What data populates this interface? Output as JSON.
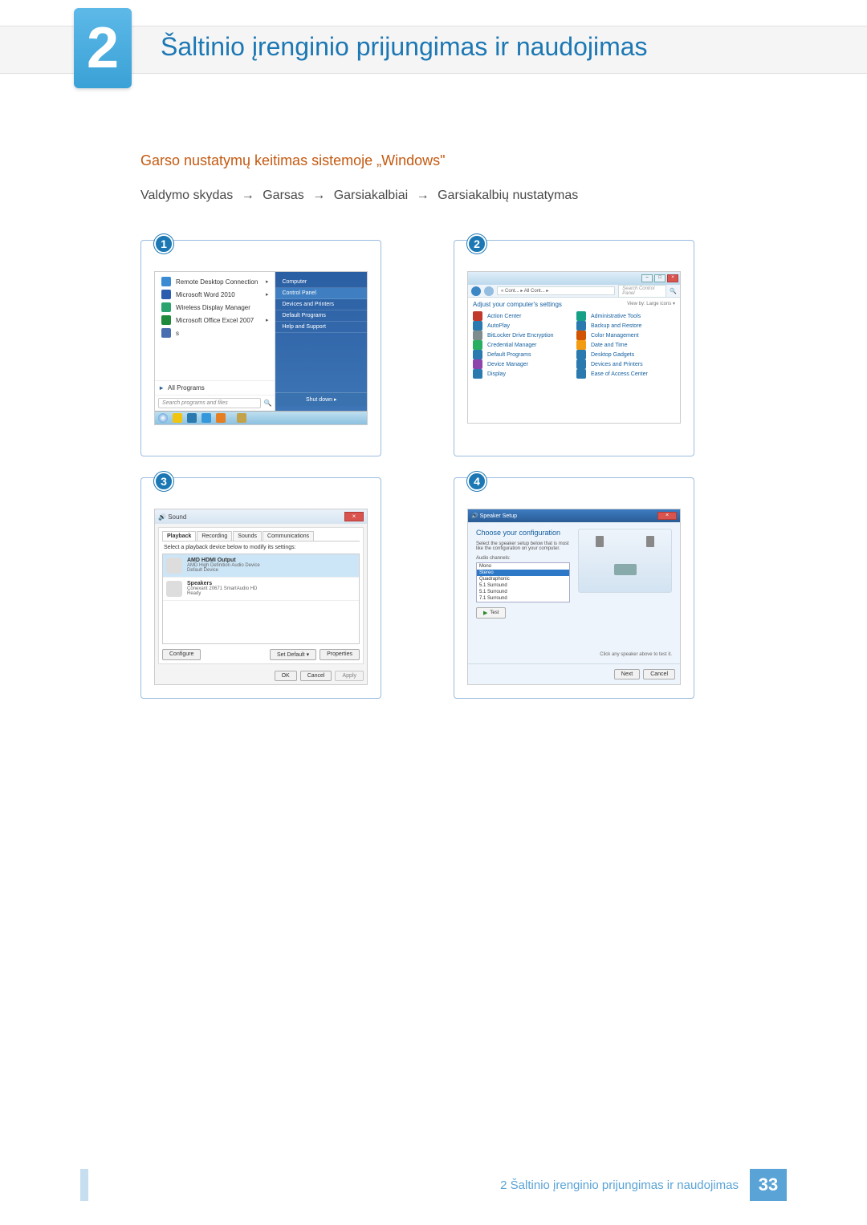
{
  "chapter": {
    "number": "2",
    "title": "Šaltinio įrenginio prijungimas ir naudojimas"
  },
  "section_heading": "Garso nustatymų keitimas sistemoje „Windows\"",
  "path": {
    "prefix": "Valdymo skydas",
    "s1": "Garsas",
    "s2": "Garsiakalbiai",
    "s3": "Garsiakalbių nustatymas",
    "arrow": "→"
  },
  "fig1": {
    "num": "1",
    "left_items": [
      {
        "label": "Remote Desktop Connection",
        "color": "#3a8bd4",
        "chev": true
      },
      {
        "label": "Microsoft Word 2010",
        "color": "#2a5db0",
        "chev": true
      },
      {
        "label": "Wireless Display Manager",
        "color": "#2aa36f",
        "chev": false
      },
      {
        "label": "Microsoft Office Excel 2007",
        "color": "#1f8a3b",
        "chev": true
      },
      {
        "label": "s",
        "color": "#4a6fb0",
        "chev": false
      }
    ],
    "all_programs": "All Programs",
    "search_placeholder": "Search programs and files",
    "right_items": [
      "Computer",
      "Control Panel",
      "Devices and Printers",
      "Default Programs",
      "Help and Support"
    ],
    "shutdown": "Shut down   ▸"
  },
  "fig2": {
    "num": "2",
    "breadcrumb": "« Cont... ▸ All Cont... ▸",
    "search_placeholder": "Search Control Panel",
    "subtitle": "Adjust your computer's settings",
    "viewby": "View by:  Large icons ▾",
    "items_left": [
      {
        "label": "Action Center",
        "color": "#c0392b"
      },
      {
        "label": "AutoPlay",
        "color": "#2a7ab0"
      },
      {
        "label": "BitLocker Drive Encryption",
        "color": "#7f8c8d"
      },
      {
        "label": "Credential Manager",
        "color": "#27ae60"
      },
      {
        "label": "Default Programs",
        "color": "#2a7ab0"
      },
      {
        "label": "Device Manager",
        "color": "#8e44ad"
      },
      {
        "label": "Display",
        "color": "#2a7ab0"
      }
    ],
    "items_right": [
      {
        "label": "Administrative Tools",
        "color": "#16a085"
      },
      {
        "label": "Backup and Restore",
        "color": "#2a7ab0"
      },
      {
        "label": "Color Management",
        "color": "#d35400"
      },
      {
        "label": "Date and Time",
        "color": "#f39c12"
      },
      {
        "label": "Desktop Gadgets",
        "color": "#2a7ab0"
      },
      {
        "label": "Devices and Printers",
        "color": "#2a7ab0"
      },
      {
        "label": "Ease of Access Center",
        "color": "#2a7ab0"
      }
    ]
  },
  "fig3": {
    "num": "3",
    "title": "Sound",
    "tabs": [
      "Playback",
      "Recording",
      "Sounds",
      "Communications"
    ],
    "instruction": "Select a playback device below to modify its settings:",
    "devices": [
      {
        "name": "AMD HDMI Output",
        "sub1": "AMD High Definition Audio Device",
        "sub2": "Default Device",
        "selected": true
      },
      {
        "name": "Speakers",
        "sub1": "Conexant 20671 SmartAudio HD",
        "sub2": "Ready",
        "selected": false
      }
    ],
    "configure": "Configure",
    "set_default": "Set Default  ▾",
    "properties": "Properties",
    "ok": "OK",
    "cancel": "Cancel",
    "apply": "Apply"
  },
  "fig4": {
    "num": "4",
    "title": "Speaker Setup",
    "heading": "Choose your configuration",
    "desc": "Select the speaker setup below that is most like the configuration on your computer.",
    "channels_label": "Audio channels:",
    "channels": [
      "Mono",
      "Stereo",
      "Quadraphonic",
      "5.1 Surround",
      "5.1 Surround",
      "7.1 Surround"
    ],
    "selected_channel": 1,
    "test": "Test",
    "hint": "Click any speaker above to test it.",
    "next": "Next",
    "cancel": "Cancel"
  },
  "footer": {
    "text": "2 Šaltinio įrenginio prijungimas ir naudojimas",
    "page": "33"
  }
}
